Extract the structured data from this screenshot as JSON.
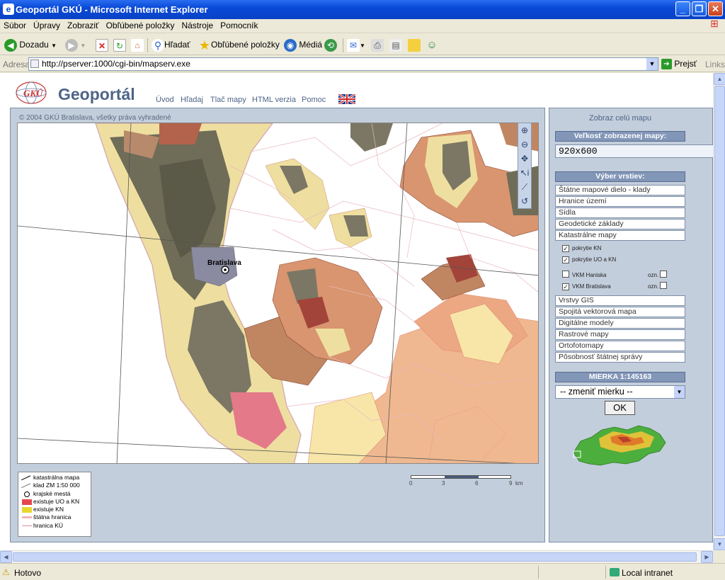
{
  "window": {
    "title": "Geoportál GKÚ - Microsoft Internet Explorer"
  },
  "menu": [
    "Súbor",
    "Úpravy",
    "Zobraziť",
    "Obľúbené položky",
    "Nástroje",
    "Pomocník"
  ],
  "toolbar": {
    "back": "Dozadu",
    "search": "Hľadať",
    "favorites": "Obľúbené položky",
    "media": "Médiá"
  },
  "address": {
    "label": "Adresa",
    "url": "http://pserver:1000/cgi-bin/mapserv.exe",
    "go": "Prejsť",
    "links": "Links"
  },
  "page": {
    "brand": "Geoportál",
    "nav": [
      "Úvod",
      "Hľadaj",
      "Tlač mapy",
      "HTML verzia",
      "Pomoc"
    ],
    "copyright": "© 2004 GKÚ Bratislava, všetky práva vyhradené",
    "city_label": "Bratislava",
    "legend": [
      "katastrálna mapa",
      "klad ZM 1:50 000",
      "krajské mestá",
      "existuje UO a KN",
      "existuje KN",
      "štátna hranica",
      "hranica KÚ"
    ],
    "scale_ticks": [
      "0",
      "3",
      "6",
      "9"
    ],
    "scale_unit": "km"
  },
  "panel": {
    "show_all": "Zobraz celú mapu",
    "size_heading": "Veľkosť zobrazenej mapy:",
    "size_value": "920x600",
    "layers_heading": "Výber vrstiev:",
    "layers_top": [
      "Štátne mapové dielo - klady",
      "Hranice území",
      "Sídla",
      "Geodetické základy",
      "Katastrálne mapy"
    ],
    "sublayers": [
      {
        "label": "pokrytie KN",
        "checked": true
      },
      {
        "label": "pokrytie UO a KN",
        "checked": true
      },
      {
        "label": "VKM Haniska",
        "checked": false,
        "ozn": "ozn."
      },
      {
        "label": "VKM Bratislava",
        "checked": true,
        "ozn": "ozn."
      }
    ],
    "layers_bottom": [
      "Vrstvy GIS",
      "Spojitá vektorová mapa",
      "Digitálne modely",
      "Rastrové mapy",
      "Ortofotomapy",
      "Pôsobnosť štátnej správy"
    ],
    "scale_heading": "MIERKA 1:145163",
    "scale_select": "-- zmeniť mierku --",
    "ok": "OK"
  },
  "status": {
    "text": "Hotovo",
    "zone": "Local intranet"
  },
  "colors": {
    "header_text": "#4e6487",
    "panel_bg": "#c3cedc",
    "section_bg": "#8296b8",
    "kn_red": "#e4484d",
    "kn_yellow": "#e6d830"
  }
}
